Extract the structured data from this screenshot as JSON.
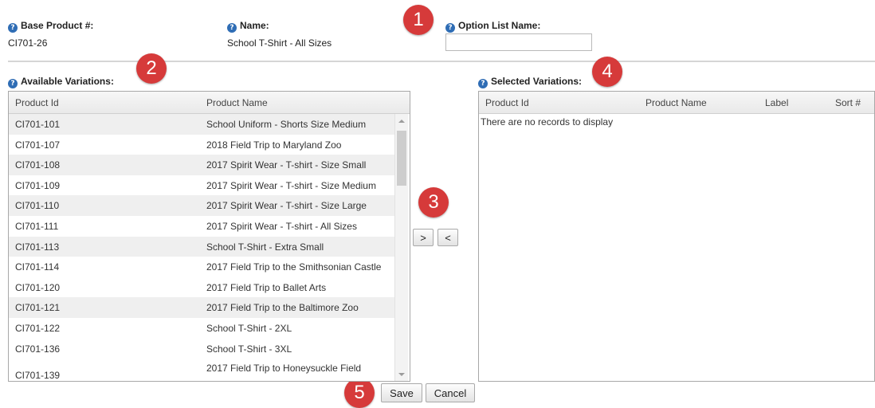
{
  "header": {
    "base_product_label": "Base Product #:",
    "base_product_value": "CI701-26",
    "name_label": "Name:",
    "name_value": "School T-Shirt - All Sizes",
    "option_list_label": "Option List Name:",
    "option_list_value": "",
    "help_glyph": "?"
  },
  "markers": [
    "1",
    "2",
    "3",
    "4",
    "5"
  ],
  "available": {
    "title": "Available Variations:",
    "columns": [
      "Product Id",
      "Product Name"
    ],
    "rows": [
      [
        "CI701-101",
        "School Uniform - Shorts Size Medium"
      ],
      [
        "CI701-107",
        "2018 Field Trip to Maryland Zoo"
      ],
      [
        "CI701-108",
        "2017 Spirit Wear - T-shirt - Size Small"
      ],
      [
        "CI701-109",
        "2017 Spirit Wear - T-shirt - Size Medium"
      ],
      [
        "CI701-110",
        "2017 Spirit Wear - T-shirt - Size Large"
      ],
      [
        "CI701-111",
        "2017 Spirit Wear - T-shirt - All Sizes"
      ],
      [
        "CI701-113",
        "School T-Shirt - Extra Small"
      ],
      [
        "CI701-114",
        "2017 Field Trip to the Smithsonian Castle"
      ],
      [
        "CI701-120",
        "2017 Field Trip to Ballet Arts"
      ],
      [
        "CI701-121",
        "2017 Field Trip to the Baltimore Zoo"
      ],
      [
        "CI701-122",
        "School T-Shirt - 2XL"
      ],
      [
        "CI701-136",
        "School T-Shirt - 3XL"
      ],
      [
        "CI701-139",
        "2017 Field Trip to Honeysuckle Field"
      ]
    ]
  },
  "selected": {
    "title": "Selected Variations:",
    "columns": [
      "Product Id",
      "Product Name",
      "Label",
      "Sort #"
    ],
    "empty_message": "There are no records to display"
  },
  "transfer": {
    "add_label": ">",
    "remove_label": "<"
  },
  "actions": {
    "save_label": "Save",
    "cancel_label": "Cancel"
  },
  "colors": {
    "marker": "#d63a3a",
    "help_icon": "#2f6db5",
    "alt_row": "#efefef"
  }
}
